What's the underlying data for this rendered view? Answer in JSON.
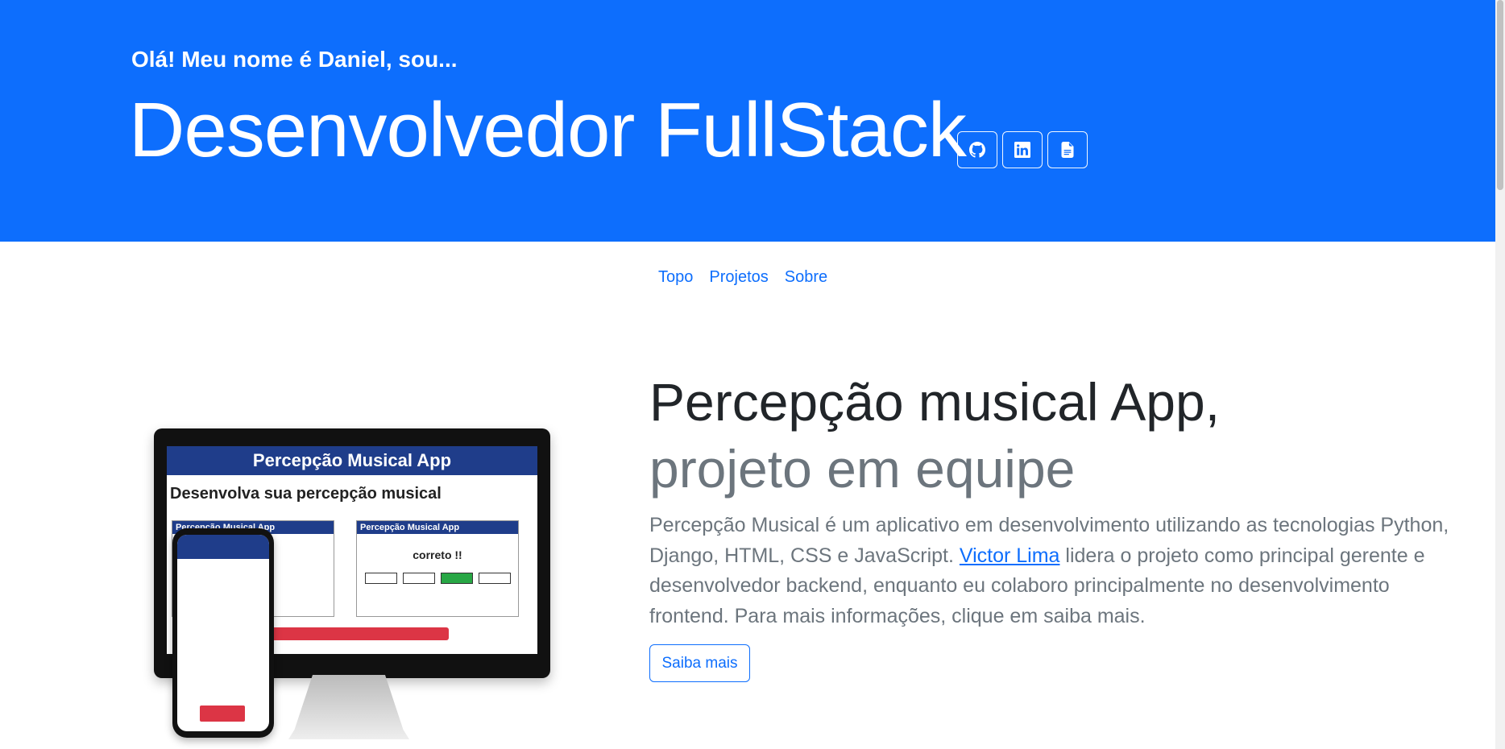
{
  "hero": {
    "subtitle": "Olá! Meu nome é Daniel, sou...",
    "title": "Desenvolvedor FullStack",
    "icons": [
      "github-icon",
      "linkedin-icon",
      "document-icon"
    ],
    "background_color": "#0d6efd"
  },
  "nav": {
    "items": [
      "Topo",
      "Projetos",
      "Sobre"
    ]
  },
  "project": {
    "title": "Percepção musical App,",
    "subtitle": "projeto em equipe",
    "description_part1": "Percepção Musical é um aplicativo em desenvolvimento utilizando as tecnologias Python, Django, HTML, CSS e JavaScript. ",
    "link_text": "Victor Lima",
    "description_part2": " lidera o projeto como principal gerente e desenvolvedor backend, enquanto eu colaboro principalmente no desenvolvimento frontend. Para mais informações, clique em saiba mais.",
    "button_label": "Saiba mais",
    "mockup": {
      "app_title": "Percepção Musical App",
      "heading": "Desenvolva sua percepção musical",
      "panel_title": "Percepção Musical App",
      "panel_text": "correto !!"
    }
  },
  "colors": {
    "accent": "#0d6efd",
    "text_muted": "#6c757d"
  }
}
